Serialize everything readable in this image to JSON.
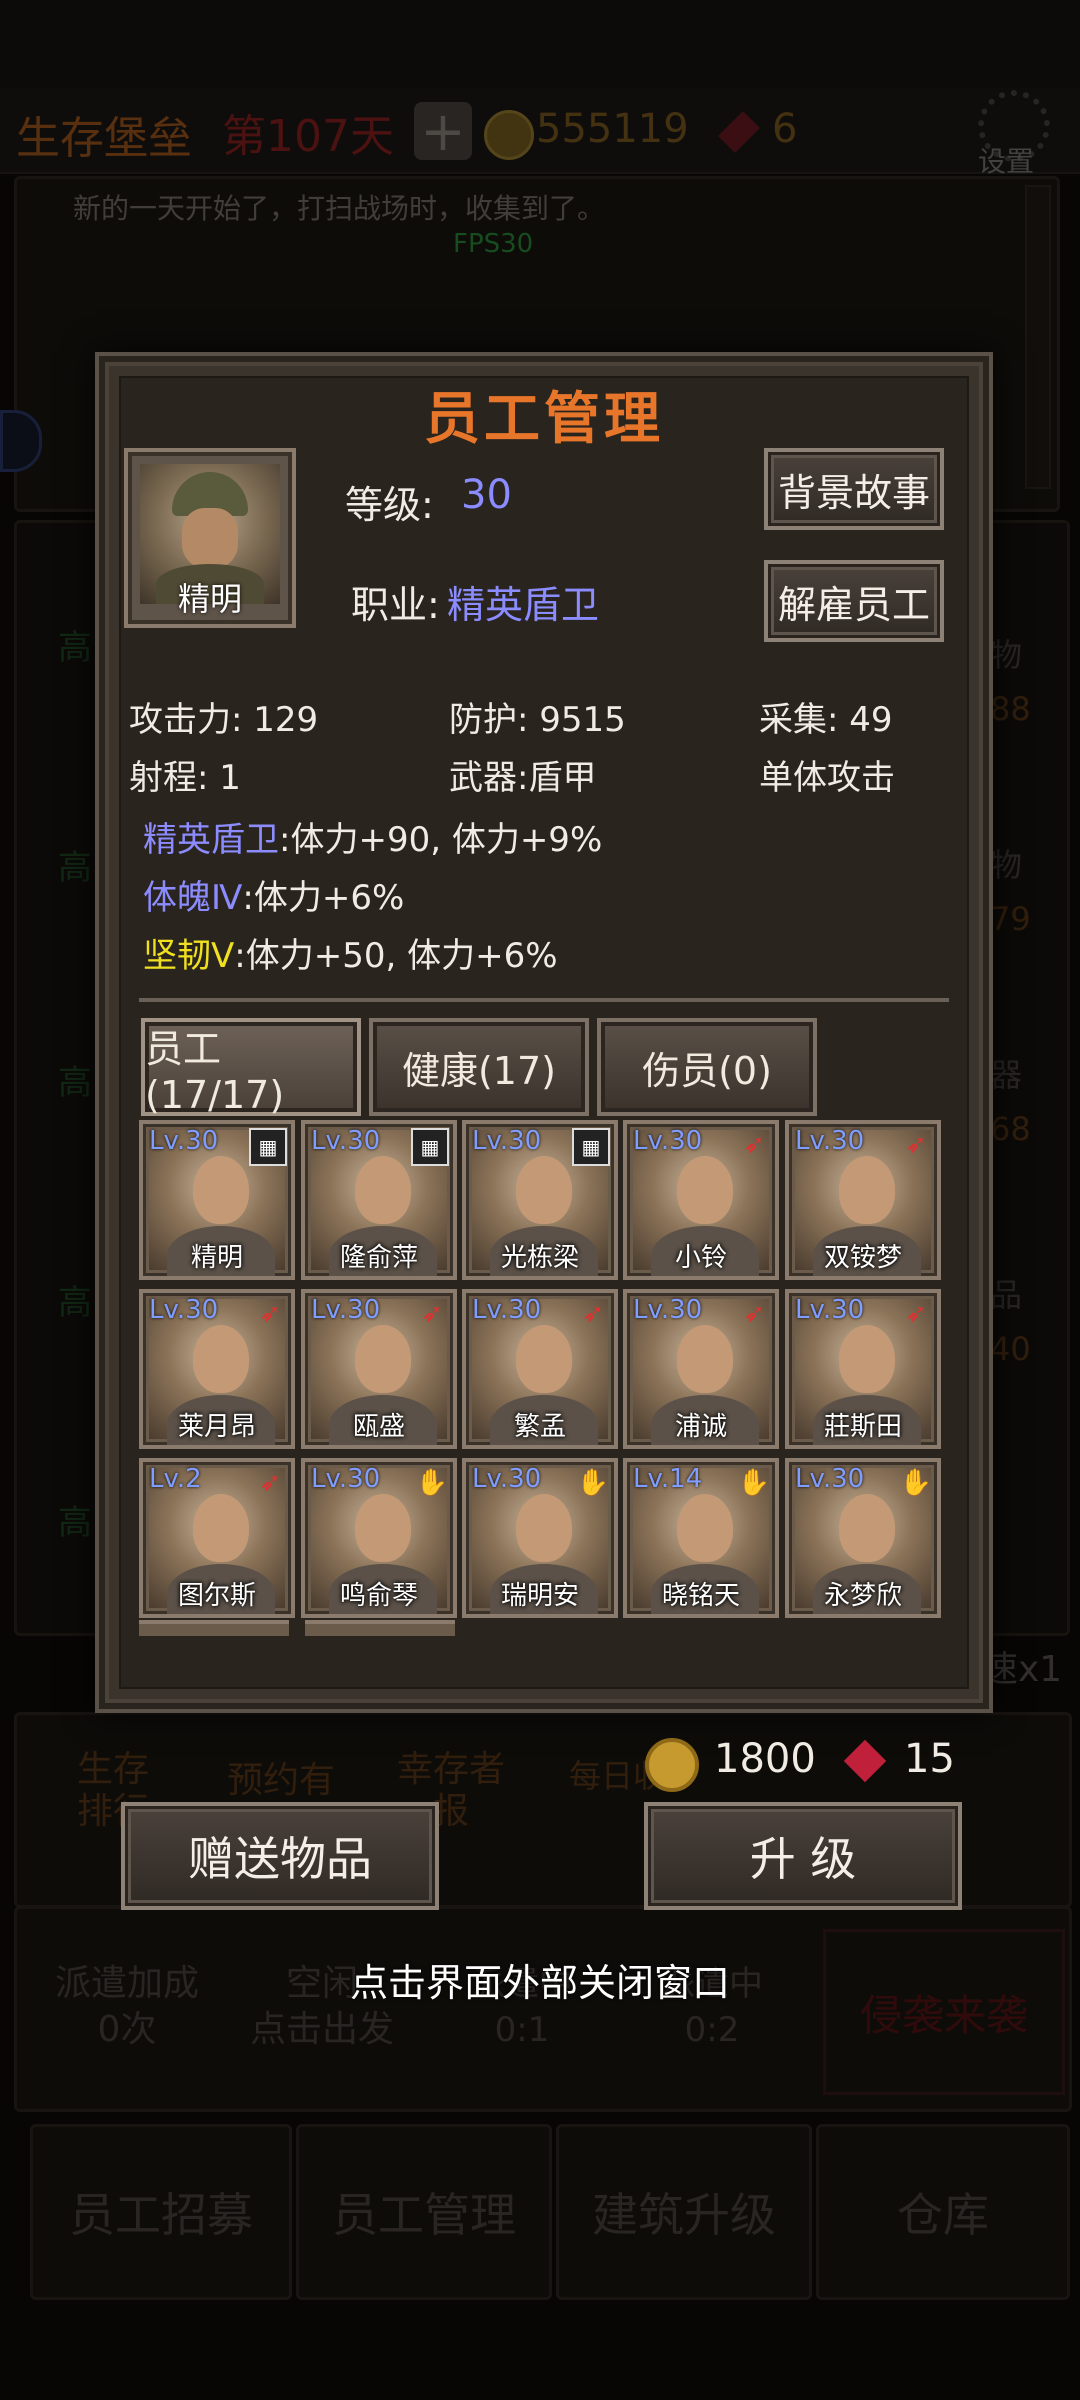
{
  "topbar": {
    "title": "生存堡垒",
    "day": "第107天",
    "plus_icon": "plus-icon",
    "gold": "555119",
    "gems": "6",
    "settings_label": "设置"
  },
  "log": {
    "message": "新的一天开始了，打扫战场时，收集到了。",
    "fps": "FPS30"
  },
  "side_left": [
    "高",
    "高",
    "高",
    "高",
    "高"
  ],
  "side_right": [
    {
      "label": "物",
      "value": "88"
    },
    {
      "label": "物",
      "value": "79"
    },
    {
      "label": "器",
      "value": "68"
    },
    {
      "label": "品",
      "value": "40"
    }
  ],
  "speed_label": "速x1",
  "bg_row": {
    "item1_line1": "生存",
    "item1_line2": "排行",
    "item2_line1": "预约有",
    "item3_line1": "幸存者",
    "item3_line2": "报",
    "item4_line1": "每日收"
  },
  "dispatch": {
    "bonus_line1": "派遣加成",
    "bonus_line2": "0次",
    "idle_line1": "空闲",
    "idle_line2": "点击出发",
    "slot2_line1": "派遣中",
    "slot2_line2": "0:1",
    "slot3_line1": "派遣中",
    "slot3_line2": "0:2",
    "invasion": "侵袭来袭"
  },
  "bottom_nav": [
    "员工招募",
    "员工管理",
    "建筑升级",
    "仓库"
  ],
  "dialog": {
    "title": "员工管理",
    "selected_name": "精明",
    "level_label": "等级:",
    "level_value": "30",
    "job_label": "职业:",
    "job_value": "精英盾卫",
    "story_button": "背景故事",
    "fire_button": "解雇员工",
    "stats": {
      "attack": "攻击力: 129",
      "defense": "防护: 9515",
      "gather": "采集: 49",
      "range": "射程: 1",
      "weapon": "武器:盾甲",
      "attack_type": "单体攻击"
    },
    "traits": [
      {
        "name": "精英盾卫",
        "effect": ":体力+90, 体力+9%",
        "color": "#8c8cff"
      },
      {
        "name": "体魄Ⅳ",
        "effect": ":体力+6%",
        "color": "#8c8cff"
      },
      {
        "name": "坚韧Ⅴ",
        "effect": ":体力+50, 体力+6%",
        "color": "#f0e020"
      }
    ],
    "tabs": [
      "员工(17/17)",
      "健康(17)",
      "伤员(0)"
    ],
    "employees": [
      {
        "lv": "Lv.30",
        "name": "精明",
        "icon": "shield-icon"
      },
      {
        "lv": "Lv.30",
        "name": "隆俞萍",
        "icon": "shield-icon"
      },
      {
        "lv": "Lv.30",
        "name": "光栋梁",
        "icon": "shield-icon"
      },
      {
        "lv": "Lv.30",
        "name": "小铃",
        "icon": "bow-icon"
      },
      {
        "lv": "Lv.30",
        "name": "双铵梦",
        "icon": "bow-icon"
      },
      {
        "lv": "Lv.30",
        "name": "莱月昂",
        "icon": "bow-icon"
      },
      {
        "lv": "Lv.30",
        "name": "瓯盛",
        "icon": "bow-icon"
      },
      {
        "lv": "Lv.30",
        "name": "繁孟",
        "icon": "bow-icon"
      },
      {
        "lv": "Lv.30",
        "name": "浦诚",
        "icon": "bow-icon"
      },
      {
        "lv": "Lv.30",
        "name": "莊斯田",
        "icon": "bow-icon"
      },
      {
        "lv": "Lv.2",
        "name": "图尔斯",
        "icon": "bow-icon"
      },
      {
        "lv": "Lv.30",
        "name": "鸣俞琴",
        "icon": "glove-icon"
      },
      {
        "lv": "Lv.30",
        "name": "瑞明安",
        "icon": "glove-icon"
      },
      {
        "lv": "Lv.14",
        "name": "晓铭天",
        "icon": "glove-icon"
      },
      {
        "lv": "Lv.30",
        "name": "永梦欣",
        "icon": "glove-icon"
      }
    ],
    "cost_gold": "1800",
    "cost_gems": "15",
    "gift_button": "赠送物品",
    "upgrade_button": "升 级",
    "close_hint": "点击界面外部关闭窗口"
  }
}
